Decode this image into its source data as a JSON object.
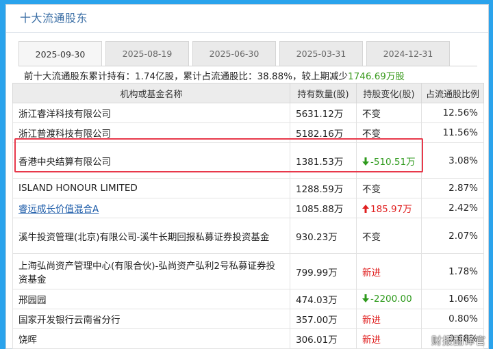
{
  "panel": {
    "title": "十大流通股东"
  },
  "tabs": [
    {
      "label": "2025-09-30",
      "active": true
    },
    {
      "label": "2025-08-19",
      "active": false
    },
    {
      "label": "2025-06-30",
      "active": false
    },
    {
      "label": "2025-03-31",
      "active": false
    },
    {
      "label": "2024-12-31",
      "active": false
    }
  ],
  "summary": {
    "prefix": "前十大流通股东累计持有：",
    "total": "1.74亿股",
    "mid": "，累计占流通股比：",
    "ratio": "38.88%",
    "tail": "，较上期减少",
    "change": "1746.69万股"
  },
  "table": {
    "headers": [
      "机构或基金名称",
      "持有数量(股)",
      "持股变化(股)",
      "占流通股比例"
    ],
    "rows": [
      {
        "name": "浙江睿洋科技有限公司",
        "qty": "5631.12万",
        "change": "不变",
        "dir": "same",
        "ratio": "12.56%"
      },
      {
        "name": "浙江普渡科技有限公司",
        "qty": "5182.16万",
        "change": "不变",
        "dir": "same",
        "ratio": "11.56%"
      },
      {
        "name": "香港中央结算有限公司",
        "qty": "1381.53万",
        "change": "-510.51万",
        "dir": "down",
        "ratio": "3.08%"
      },
      {
        "name": "ISLAND HONOUR LIMITED",
        "qty": "1288.59万",
        "change": "不变",
        "dir": "same",
        "ratio": "2.87%"
      },
      {
        "name": "睿远成长价值混合A",
        "qty": "1085.88万",
        "change": "185.97万",
        "dir": "up",
        "ratio": "2.42%",
        "link": true
      },
      {
        "name": "溪牛投资管理(北京)有限公司-溪牛长期回报私募证券投资基金",
        "qty": "930.23万",
        "change": "不变",
        "dir": "same",
        "ratio": "2.07%"
      },
      {
        "name": "上海弘尚资产管理中心(有限合伙)-弘尚资产弘利2号私募证券投资基金",
        "qty": "799.99万",
        "change": "新进",
        "dir": "new",
        "ratio": "1.78%"
      },
      {
        "name": "邢园园",
        "qty": "474.03万",
        "change": "-2200.00",
        "dir": "down",
        "ratio": "1.06%"
      },
      {
        "name": "国家开发银行云南省分行",
        "qty": "357.00万",
        "change": "新进",
        "dir": "new",
        "ratio": "0.80%"
      },
      {
        "name": "饶晖",
        "qty": "306.01万",
        "change": "新进",
        "dir": "new",
        "ratio": "0.68%"
      }
    ]
  },
  "icons": {
    "down": "arrow-down-icon",
    "up": "arrow-up-icon"
  },
  "colors": {
    "accent_green": "#3a9a1e",
    "up_red": "#e02020",
    "down_green": "#2e9a1c",
    "highlight": "#e8384a",
    "link": "#1a5aa8"
  },
  "watermark": "财报翻译官"
}
